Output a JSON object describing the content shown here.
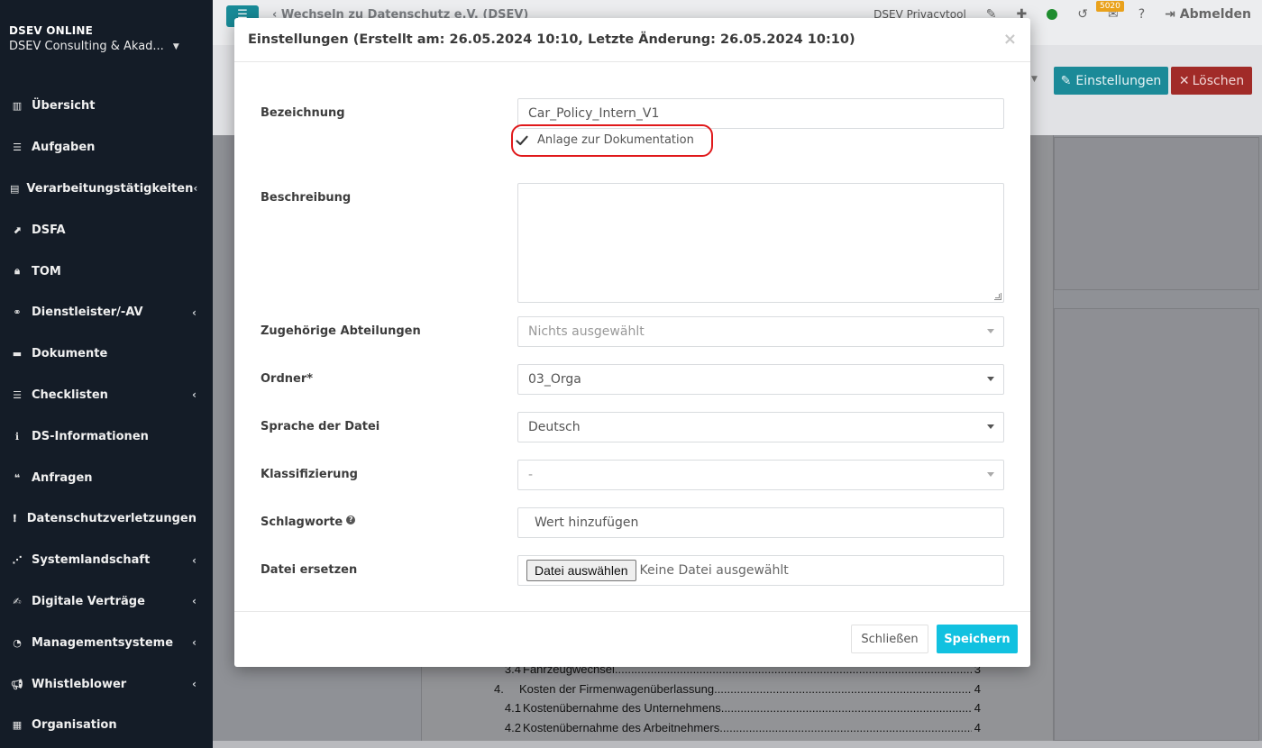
{
  "sidebar": {
    "brand_title": "DSEV ONLINE",
    "company": "DSEV Consulting & Akad...",
    "items": [
      {
        "label": "Übersicht",
        "icon": "chart-bar-icon",
        "has_submenu": false
      },
      {
        "label": "Aufgaben",
        "icon": "tasks-icon",
        "has_submenu": false
      },
      {
        "label": "Verarbeitungstätigkeiten",
        "icon": "table-list-icon",
        "has_submenu": true
      },
      {
        "label": "DSFA",
        "icon": "chart-line-icon",
        "has_submenu": false
      },
      {
        "label": "TOM",
        "icon": "lock-icon",
        "has_submenu": false
      },
      {
        "label": "Dienstleister/-AV",
        "icon": "handshake-icon",
        "has_submenu": true
      },
      {
        "label": "Dokumente",
        "icon": "folder-icon",
        "has_submenu": false
      },
      {
        "label": "Checklisten",
        "icon": "list-icon",
        "has_submenu": true
      },
      {
        "label": "DS-Informationen",
        "icon": "info-square-icon",
        "has_submenu": false
      },
      {
        "label": "Anfragen",
        "icon": "comments-icon",
        "has_submenu": false
      },
      {
        "label": "Datenschutzverletzungen",
        "icon": "exclamation-circle-icon",
        "has_submenu": false
      },
      {
        "label": "Systemlandschaft",
        "icon": "network-icon",
        "has_submenu": true
      },
      {
        "label": "Digitale Verträge",
        "icon": "file-signature-icon",
        "has_submenu": true
      },
      {
        "label": "Managementsysteme",
        "icon": "gauge-icon",
        "has_submenu": true
      },
      {
        "label": "Whistleblower",
        "icon": "megaphone-icon",
        "has_submenu": true
      },
      {
        "label": "Organisation",
        "icon": "building-icon",
        "has_submenu": false
      }
    ]
  },
  "topbar": {
    "breadcrumb": "Wechseln zu Datenschutz e.V. (DSEV)",
    "app_name": "DSEV Privacytool",
    "mail_count": "5020",
    "logout": "Abmelden",
    "status_color": "#1f8d2f"
  },
  "actions": {
    "settings": "Einstellungen",
    "delete": "Löschen"
  },
  "background_toc": [
    {
      "num": "3.4",
      "text": "Fahrzeugwechsel",
      "page": "3",
      "major": false
    },
    {
      "num": "4.",
      "text": "Kosten der Firmenwagenüberlassung",
      "page": "4",
      "major": true
    },
    {
      "num": "4.1",
      "text": "Kostenübernahme des Unternehmens",
      "page": "4",
      "major": false
    },
    {
      "num": "4.2",
      "text": "Kostenübernahme des Arbeitnehmers",
      "page": "4",
      "major": false
    }
  ],
  "modal": {
    "title": "Einstellungen (Erstellt am: 26.05.2024 10:10, Letzte Änderung: 26.05.2024 10:10)",
    "close_symbol": "×",
    "fields": {
      "bezeichnung_label": "Bezeichnung",
      "bezeichnung_value": "Car_Policy_Intern_V1",
      "checkbox_label": "Anlage zur Dokumentation",
      "checkbox_checked": true,
      "beschreibung_label": "Beschreibung",
      "beschreibung_value": "",
      "abteilungen_label": "Zugehörige Abteilungen",
      "abteilungen_value": "Nichts ausgewählt",
      "ordner_label": "Ordner*",
      "ordner_value": "03_Orga",
      "sprache_label": "Sprache der Datei",
      "sprache_value": "Deutsch",
      "klassifizierung_label": "Klassifizierung",
      "klassifizierung_value": "-",
      "schlagworte_label": "Schlagworte",
      "schlagworte_placeholder": "Wert hinzufügen",
      "datei_label": "Datei ersetzen",
      "datei_button": "Datei auswählen",
      "datei_status": "Keine Datei ausgewählt"
    },
    "footer": {
      "close": "Schließen",
      "save": "Speichern"
    }
  },
  "colors": {
    "sidebar_bg": "#141c27",
    "primary": "#11c1e0",
    "teal": "#188b98",
    "danger": "#a12b28",
    "highlight": "#e0191b"
  }
}
